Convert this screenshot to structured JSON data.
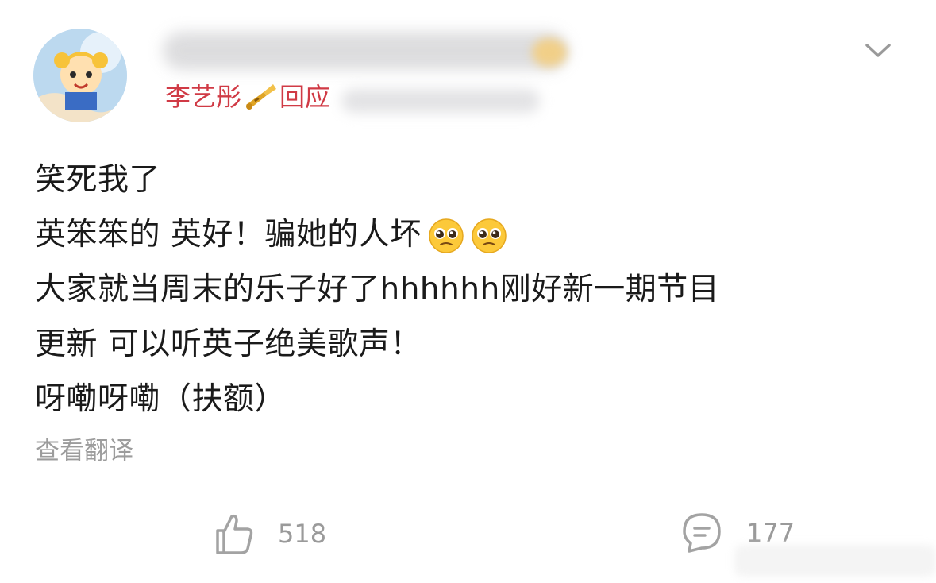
{
  "post": {
    "reply_name": "李艺彤",
    "reply_suffix": "回应",
    "lines": [
      "笑死我了",
      "英笨笨的 英好！骗她的人坏",
      "大家就当周末的乐子好了hhhhhh刚好新一期节目",
      "更新 可以听英子绝美歌声！",
      "呀嘞呀嘞（扶额）"
    ],
    "translate_label": "查看翻译"
  },
  "actions": {
    "like_count": "518",
    "comment_count": "177"
  },
  "colors": {
    "reply_name": "#d03a45",
    "text": "#1a1a1a",
    "muted": "#9c9c9c"
  },
  "icons": [
    "avatar",
    "trumpet-icon",
    "chevron-down-icon",
    "pleading-face-emoji",
    "thumbs-up-icon",
    "comment-icon"
  ]
}
